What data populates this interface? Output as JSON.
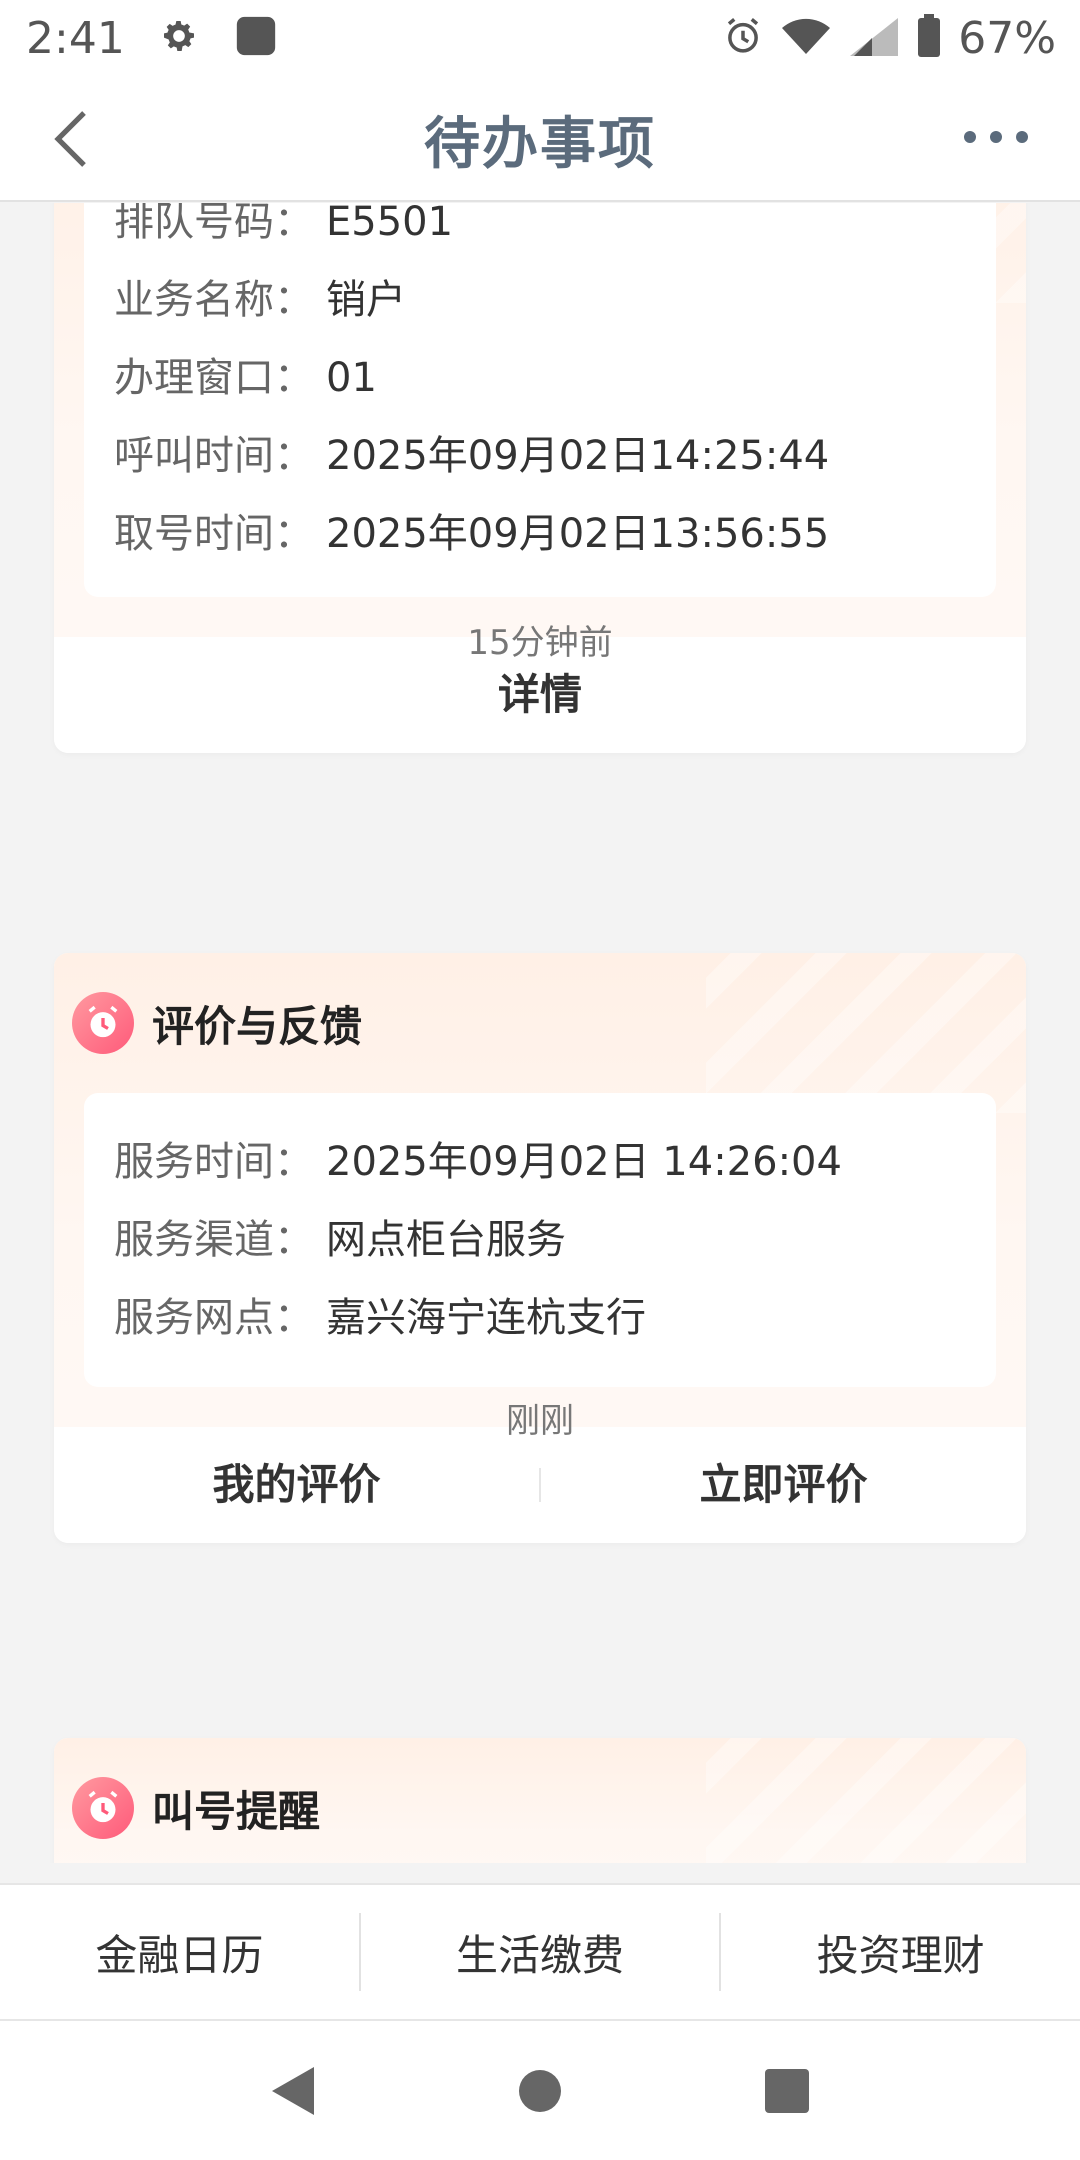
{
  "status_bar": {
    "time": "2:41",
    "battery": "67%",
    "icons": [
      "settings-gear-icon",
      "app-square-icon",
      "alarm-icon",
      "wifi-icon",
      "signal-icon",
      "battery-icon"
    ]
  },
  "header": {
    "title": "待办事项",
    "back_icon": "chevron-left-icon",
    "more_icon": "more-dots-icon"
  },
  "queue_card": {
    "rows": [
      {
        "key": "排队号码：",
        "value": "E5501"
      },
      {
        "key": "业务名称：",
        "value": "销户"
      },
      {
        "key": "办理窗口：",
        "value": "01"
      },
      {
        "key": "呼叫时间：",
        "value": "2025年09月02日14:25:44"
      },
      {
        "key": "取号时间：",
        "value": "2025年09月02日13:56:55"
      }
    ],
    "action": "详情"
  },
  "feedback_section": {
    "timestamp": "15分钟前",
    "title": "评价与反馈",
    "rows": [
      {
        "key": "服务时间：",
        "value": "2025年09月02日 14:26:04"
      },
      {
        "key": "服务渠道：",
        "value": "网点柜台服务"
      },
      {
        "key": "服务网点：",
        "value": "嘉兴海宁连杭支行"
      }
    ],
    "actions": [
      "我的评价",
      "立即评价"
    ]
  },
  "call_section": {
    "timestamp": "刚刚",
    "title": "叫号提醒"
  },
  "tab_bar": {
    "items": [
      "金融日历",
      "生活缴费",
      "投资理财"
    ]
  },
  "colors": {
    "title": "#5b6b7c",
    "card_gradient_start": "#fff0e6",
    "icon_pink": "#ff5a7a",
    "page_bg": "#f3f3f3"
  }
}
